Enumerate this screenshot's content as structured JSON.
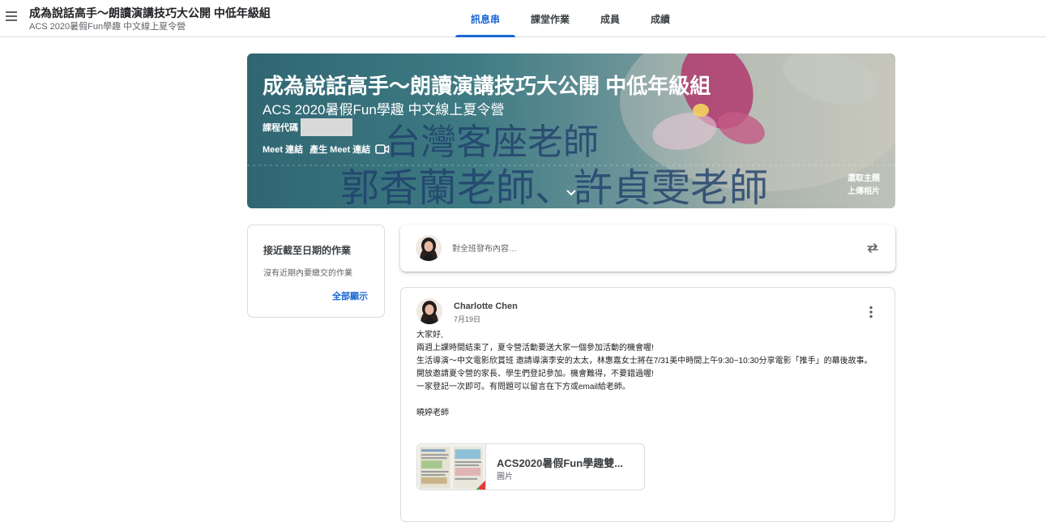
{
  "header": {
    "title": "成為說話高手～朗讀演講技巧大公開 中低年級組",
    "subtitle": "ACS 2020暑假Fun學趣 中文線上夏令營",
    "tabs": [
      {
        "label": "訊息串",
        "active": true
      },
      {
        "label": "課堂作業",
        "active": false
      },
      {
        "label": "成員",
        "active": false
      },
      {
        "label": "成績",
        "active": false
      }
    ]
  },
  "banner": {
    "title": "成為說話高手～朗讀演講技巧大公開 中低年級組",
    "subtitle": "ACS 2020暑假Fun學趣 中文線上夏令營",
    "code_label": "課程代碼",
    "meet_label": "Meet 連結",
    "meet_link": "產生 Meet 連結",
    "select_theme": "選取主題",
    "upload_photo": "上傳相片",
    "art_text_line1": "台灣客座老師",
    "art_text_line2": "郭香蘭老師、許貞雯老師"
  },
  "upcoming": {
    "title": "接近截至日期的作業",
    "empty": "沒有近期內要繳交的作業",
    "view_all": "全部顯示"
  },
  "share": {
    "placeholder": "對全班發布內容…"
  },
  "post": {
    "author": "Charlotte Chen",
    "date": "7月19日",
    "lines": [
      "大家好,",
      "兩週上課時間結束了，夏令營活動要送大家一個參加活動的機會喔!",
      "生活導演～中文電影欣賞班 邀請導演李安的太太，林惠嘉女士將在7/31美中時間上午9:30~10:30分享電影「推手」的幕後故事。",
      "開放邀請夏令營的家長、學生們登記參加。機會難得，不要錯過喔!",
      "一家登記一次即可。有問題可以留言在下方或email給老師。",
      "",
      "曉婷老師"
    ],
    "attachment": {
      "title": "ACS2020暑假Fun學趣雙...",
      "type": "圖片"
    }
  },
  "colors": {
    "accent": "#1967d2",
    "banner_teal": "#3f7b84",
    "text_primary": "#202124",
    "text_secondary": "#5f6368"
  }
}
